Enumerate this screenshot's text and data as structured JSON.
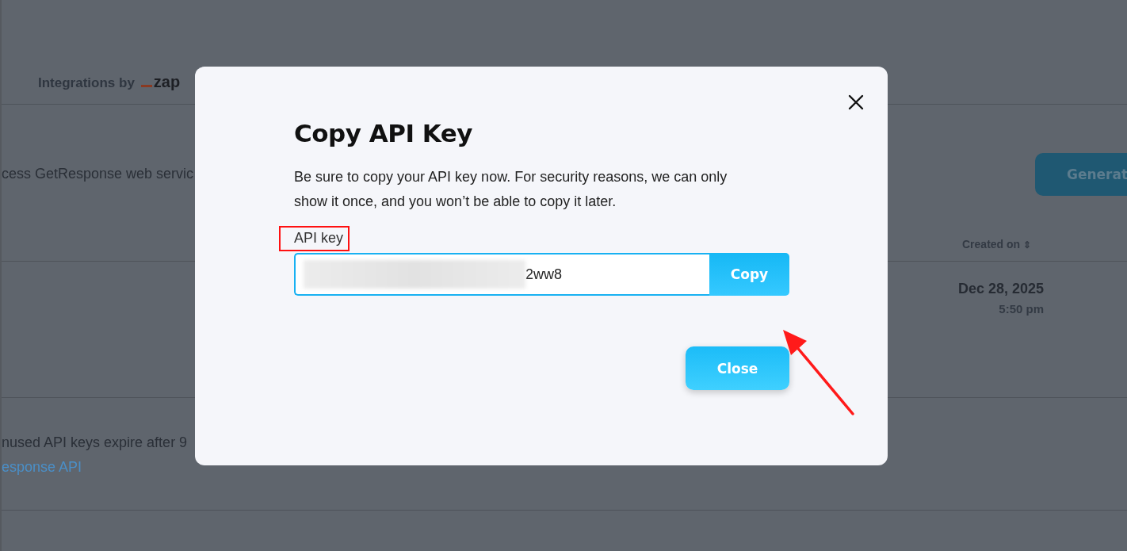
{
  "background": {
    "header": {
      "title": "Integrations by",
      "logo": "zap"
    },
    "description": "cess GetResponse web servic",
    "generate_button": "Generat",
    "table": {
      "columns": [
        {
          "label": "Created on",
          "sort_icon": "⇕"
        }
      ],
      "rows": [
        {
          "date": "Dec 28, 2025",
          "time": "5:50 pm"
        }
      ]
    },
    "note": "nused API keys expire after 9",
    "link": "esponse API"
  },
  "modal": {
    "title": "Copy API Key",
    "text": "Be sure to copy your API key now. For security reasons, we can only show it once, and you won’t be able to copy it later.",
    "field_label": "API key",
    "api_key_visible": "2ww8",
    "copy_button": "Copy",
    "close_button": "Close"
  }
}
